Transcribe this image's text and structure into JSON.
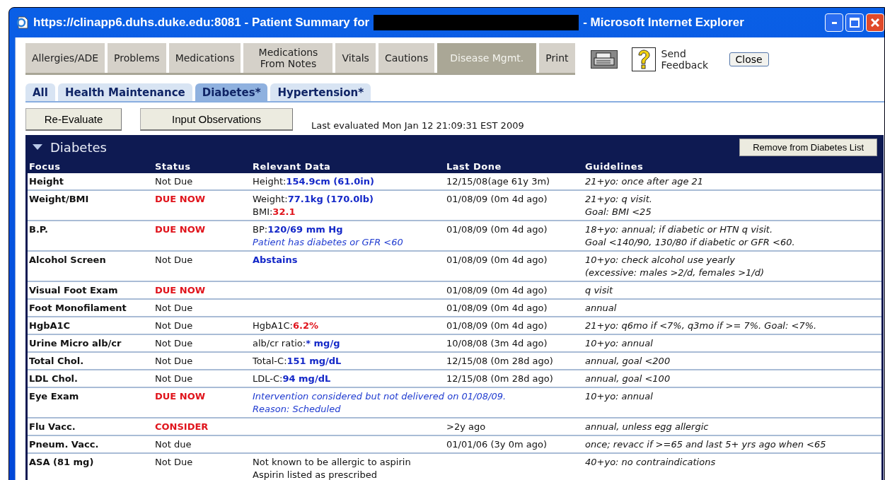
{
  "window": {
    "title": "https://clinapp6.duhs.duke.edu:8081 - Patient Summary for",
    "app": "- Microsoft Internet Explorer",
    "redacted": true
  },
  "tabs": [
    {
      "label": "Allergies/ADE",
      "selected": false
    },
    {
      "label": "Problems",
      "selected": false
    },
    {
      "label": "Medications",
      "selected": false
    },
    {
      "label": "Medications From Notes",
      "selected": false
    },
    {
      "label": "Vitals",
      "selected": false
    },
    {
      "label": "Cautions",
      "selected": false
    },
    {
      "label": "Disease Mgmt.",
      "selected": true
    },
    {
      "label": "Print",
      "selected": false
    }
  ],
  "feedback": "Send Feedback",
  "close": "Close",
  "subtabs": [
    {
      "label": "All",
      "selected": false
    },
    {
      "label": "Health Maintenance",
      "selected": false
    },
    {
      "label": "Diabetes*",
      "selected": true
    },
    {
      "label": "Hypertension*",
      "selected": false
    }
  ],
  "actions": [
    "Re-Evaluate",
    "Input Observations"
  ],
  "last_evaluated": "Last evaluated Mon Jan 12 21:09:31 EST 2009",
  "panel": {
    "title": "Diabetes",
    "expanded": true,
    "remove_button": "Remove from Diabetes List"
  },
  "table": {
    "columns": [
      "Focus",
      "Status",
      "Relevant Data",
      "Last Done",
      "Guidelines"
    ],
    "rows": [
      {
        "focus": "Height",
        "status": {
          "text": "Not Due",
          "due": false
        },
        "data": [
          {
            "kind": "measure",
            "label": "Height:",
            "value": "154.9cm (61.0in)",
            "flag": false
          }
        ],
        "last_done": "12/15/08(age 61y 3m)",
        "guidelines": [
          "21+yo: once after age 21"
        ]
      },
      {
        "focus": "Weight/BMI",
        "status": {
          "text": "DUE NOW",
          "due": true
        },
        "data": [
          {
            "kind": "measure",
            "label": "Weight:",
            "value": "77.1kg (170.0lb)",
            "flag": false
          },
          {
            "kind": "measure",
            "label": "BMI:",
            "value": "32.1",
            "flag": true
          }
        ],
        "last_done": "01/08/09 (0m 4d ago)",
        "guidelines": [
          "21+yo: q visit.",
          "Goal: BMI <25"
        ]
      },
      {
        "focus": "B.P.",
        "status": {
          "text": "DUE NOW",
          "due": true
        },
        "data": [
          {
            "kind": "measure",
            "label": "BP:",
            "value": "120/69 mm Hg",
            "flag": false
          },
          {
            "kind": "note",
            "text": "Patient has diabetes or GFR <60"
          }
        ],
        "last_done": "01/08/09 (0m 4d ago)",
        "guidelines": [
          "18+yo: annual; if diabetic or HTN q visit.",
          "Goal <140/90, 130/80 if diabetic or GFR <60."
        ]
      },
      {
        "focus": "Alcohol Screen",
        "status": {
          "text": "Not Due",
          "due": false
        },
        "data": [
          {
            "kind": "measure",
            "value": "Abstains",
            "flag": false
          }
        ],
        "last_done": "01/08/09 (0m 4d ago)",
        "guidelines": [
          "10+yo: check alcohol use yearly",
          "(excessive: males >2/d, females >1/d)"
        ]
      },
      {
        "focus": "Visual Foot Exam",
        "status": {
          "text": "DUE NOW",
          "due": true
        },
        "last_done": "01/08/09 (0m 4d ago)",
        "guidelines": [
          "q visit"
        ]
      },
      {
        "focus": "Foot Monofilament",
        "status": {
          "text": "Not Due",
          "due": false
        },
        "last_done": "01/08/09 (0m 4d ago)",
        "guidelines": [
          "annual"
        ]
      },
      {
        "focus": "HgbA1C",
        "status": {
          "text": "Not Due",
          "due": false
        },
        "data": [
          {
            "kind": "measure",
            "label": "HgbA1C:",
            "value": "6.2%",
            "flag": true
          }
        ],
        "last_done": "01/08/09 (0m 4d ago)",
        "guidelines": [
          "21+yo: q6mo if <7%, q3mo if >= 7%. Goal: <7%."
        ]
      },
      {
        "focus": "Urine Micro alb/cr",
        "status": {
          "text": "Not Due",
          "due": false
        },
        "data": [
          {
            "kind": "measure",
            "label": "alb/cr ratio:",
            "value": "* mg/g",
            "flag": false
          }
        ],
        "last_done": "10/08/08 (3m 4d ago)",
        "guidelines": [
          "10+yo: annual"
        ]
      },
      {
        "focus": "Total Chol.",
        "status": {
          "text": "Not Due",
          "due": false
        },
        "data": [
          {
            "kind": "measure",
            "label": "Total-C:",
            "value": "151 mg/dL",
            "flag": false
          }
        ],
        "last_done": "12/15/08 (0m 28d ago)",
        "guidelines": [
          "annual, goal <200"
        ]
      },
      {
        "focus": "LDL Chol.",
        "status": {
          "text": "Not Due",
          "due": false
        },
        "data": [
          {
            "kind": "measure",
            "label": "LDL-C:",
            "value": "94 mg/dL",
            "flag": false
          }
        ],
        "last_done": "12/15/08 (0m 28d ago)",
        "guidelines": [
          "annual, goal <100"
        ]
      },
      {
        "focus": "Eye Exam",
        "status": {
          "text": "DUE NOW",
          "due": true
        },
        "data": [
          {
            "kind": "note",
            "text": "Intervention considered but not delivered on 01/08/09."
          },
          {
            "kind": "note",
            "text": "Reason: Scheduled"
          }
        ],
        "guidelines": [
          "10+yo: annual"
        ]
      },
      {
        "focus": "Flu Vacc.",
        "status": {
          "text": "CONSIDER",
          "due": true
        },
        "last_done": ">2y ago",
        "guidelines": [
          "annual, unless egg allergic"
        ]
      },
      {
        "focus": "Pneum. Vacc.",
        "status": {
          "text": "Not due",
          "due": false
        },
        "last_done": "01/01/06 (3y 0m ago)",
        "guidelines": [
          "once; revacc if >=65 and last 5+ yrs ago when <65"
        ]
      },
      {
        "focus": "ASA (81 mg)",
        "status": {
          "text": "Not Due",
          "due": false
        },
        "data": [
          {
            "kind": "plain",
            "text": "Not known to be allergic to aspirin"
          },
          {
            "kind": "plain",
            "text": "Aspirin listed as prescribed"
          }
        ],
        "guidelines": [
          "40+yo: no contraindications"
        ]
      }
    ]
  }
}
